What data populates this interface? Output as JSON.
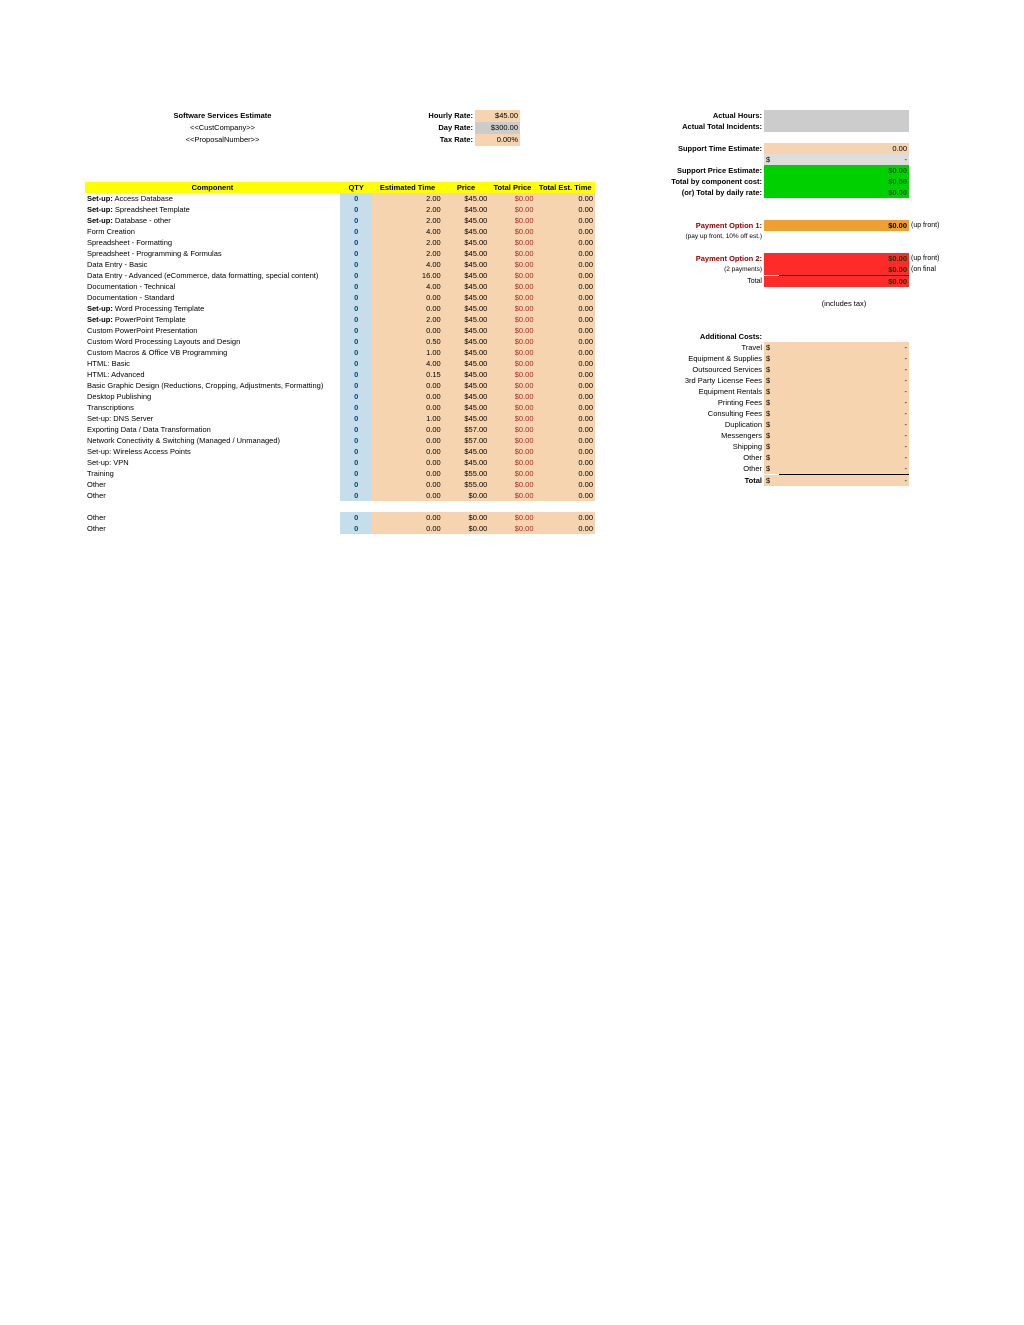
{
  "header": {
    "title": "Software Services Estimate",
    "cust": "<<CustCompany>>",
    "propno": "<<ProposalNumber>>",
    "rates": {
      "hourly_lbl": "Hourly Rate:",
      "hourly_val": "$45.00",
      "day_lbl": "Day Rate:",
      "day_val": "$300.00",
      "tax_lbl": "Tax Rate:",
      "tax_val": "0.00%"
    }
  },
  "table": {
    "hdr": {
      "component": "Component",
      "qty": "QTY",
      "est": "Estimated Time",
      "price": "Price",
      "tprice": "Total Price",
      "ttime": "Total Est. Time"
    },
    "rows": [
      {
        "name": "__B__Set-up:__N__ Access Database",
        "qty": "0",
        "est": "2.00",
        "price": "$45.00",
        "tp": "$0.00",
        "tt": "0.00"
      },
      {
        "name": "__B__Set-up:__N__ Spreadsheet Template",
        "qty": "0",
        "est": "2.00",
        "price": "$45.00",
        "tp": "$0.00",
        "tt": "0.00"
      },
      {
        "name": "__B__Set-up:__N__ Database - other",
        "qty": "0",
        "est": "2.00",
        "price": "$45.00",
        "tp": "$0.00",
        "tt": "0.00"
      },
      {
        "name": "Form Creation",
        "qty": "0",
        "est": "4.00",
        "price": "$45.00",
        "tp": "$0.00",
        "tt": "0.00"
      },
      {
        "name": "Spreadsheet - Formatting",
        "qty": "0",
        "est": "2.00",
        "price": "$45.00",
        "tp": "$0.00",
        "tt": "0.00"
      },
      {
        "name": "Spreadsheet - Programming & Formulas",
        "qty": "0",
        "est": "2.00",
        "price": "$45.00",
        "tp": "$0.00",
        "tt": "0.00"
      },
      {
        "name": "Data Entry - Basic",
        "qty": "0",
        "est": "4.00",
        "price": "$45.00",
        "tp": "$0.00",
        "tt": "0.00"
      },
      {
        "name": "Data Entry - Advanced (eCommerce, data formatting, special content)",
        "qty": "0",
        "est": "16.00",
        "price": "$45.00",
        "tp": "$0.00",
        "tt": "0.00"
      },
      {
        "name": "Documentation - Technical",
        "qty": "0",
        "est": "4.00",
        "price": "$45.00",
        "tp": "$0.00",
        "tt": "0.00"
      },
      {
        "name": "Documentation - Standard",
        "qty": "0",
        "est": "0.00",
        "price": "$45.00",
        "tp": "$0.00",
        "tt": "0.00"
      },
      {
        "name": "__B__Set-up:__N__ Word Processing Template",
        "qty": "0",
        "est": "0.00",
        "price": "$45.00",
        "tp": "$0.00",
        "tt": "0.00"
      },
      {
        "name": "__B__Set-up:__N__ PowerPoint Template",
        "qty": "0",
        "est": "2.00",
        "price": "$45.00",
        "tp": "$0.00",
        "tt": "0.00"
      },
      {
        "name": "Custom PowerPoint Presentation",
        "qty": "0",
        "est": "0.00",
        "price": "$45.00",
        "tp": "$0.00",
        "tt": "0.00"
      },
      {
        "name": "Custom Word Processing Layouts and Design",
        "qty": "0",
        "est": "0.50",
        "price": "$45.00",
        "tp": "$0.00",
        "tt": "0.00"
      },
      {
        "name": "Custom Macros & Office VB Programming",
        "qty": "0",
        "est": "1.00",
        "price": "$45.00",
        "tp": "$0.00",
        "tt": "0.00"
      },
      {
        "name": "HTML: Basic",
        "qty": "0",
        "est": "4.00",
        "price": "$45.00",
        "tp": "$0.00",
        "tt": "0.00"
      },
      {
        "name": "HTML: Advanced",
        "qty": "0",
        "est": "0.15",
        "price": "$45.00",
        "tp": "$0.00",
        "tt": "0.00"
      },
      {
        "name": "Basic Graphic Design (Reductions, Cropping, Adjustments, Formatting)",
        "qty": "0",
        "est": "0.00",
        "price": "$45.00",
        "tp": "$0.00",
        "tt": "0.00"
      },
      {
        "name": "Desktop Publishing",
        "qty": "0",
        "est": "0.00",
        "price": "$45.00",
        "tp": "$0.00",
        "tt": "0.00"
      },
      {
        "name": "Transcriptions",
        "qty": "0",
        "est": "0.00",
        "price": "$45.00",
        "tp": "$0.00",
        "tt": "0.00"
      },
      {
        "name": "Set-up: DNS Server",
        "qty": "0",
        "est": "1.00",
        "price": "$45.00",
        "tp": "$0.00",
        "tt": "0.00"
      },
      {
        "name": "Exporting Data / Data Transformation",
        "qty": "0",
        "est": "0.00",
        "price": "$57.00",
        "tp": "$0.00",
        "tt": "0.00"
      },
      {
        "name": "Network Conectivity & Switching (Managed / Unmanaged)",
        "qty": "0",
        "est": "0.00",
        "price": "$57.00",
        "tp": "$0.00",
        "tt": "0.00"
      },
      {
        "name": "Set-up: Wireless Access Points",
        "qty": "0",
        "est": "0.00",
        "price": "$45.00",
        "tp": "$0.00",
        "tt": "0.00"
      },
      {
        "name": "Set-up: VPN",
        "qty": "0",
        "est": "0.00",
        "price": "$45.00",
        "tp": "$0.00",
        "tt": "0.00"
      },
      {
        "name": "Training",
        "qty": "0",
        "est": "0.00",
        "price": "$55.00",
        "tp": "$0.00",
        "tt": "0.00"
      },
      {
        "name": "Other",
        "qty": "0",
        "est": "0.00",
        "price": "$55.00",
        "tp": "$0.00",
        "tt": "0.00"
      },
      {
        "name": "Other",
        "qty": "0",
        "est": "0.00",
        "price": "$0.00",
        "tp": "$0.00",
        "tt": "0.00"
      },
      {
        "name": "__BLANK__",
        "qty": "",
        "est": "",
        "price": "",
        "tp": "",
        "tt": ""
      },
      {
        "name": "Other",
        "qty": "0",
        "est": "0.00",
        "price": "$0.00",
        "tp": "$0.00",
        "tt": "0.00"
      },
      {
        "name": "Other",
        "qty": "0",
        "est": "0.00",
        "price": "$0.00",
        "tp": "$0.00",
        "tt": "0.00"
      }
    ]
  },
  "right": {
    "actual_hours_lbl": "Actual Hours:",
    "actual_incidents_lbl": "Actual Total Incidents:",
    "support_time_lbl": "Support Time Estimate:",
    "support_time_val": "0.00",
    "dash": "-",
    "dollar": "$",
    "support_price_lbl": "Support Price Estimate:",
    "support_price_val": "$0.00",
    "total_comp_lbl": "Total by component cost:",
    "total_comp_val": "$0.00",
    "total_daily_lbl": "(or) Total by daily rate:",
    "total_daily_val": "$0.00",
    "pay1_lbl": "Payment Option 1:",
    "pay1_val": "$0.00",
    "pay1_note": "(up front)",
    "pay1_sub": "(pay up front, 10% off est.)",
    "pay2_lbl": "Payment Option 2:",
    "pay2_val": "$0.00",
    "pay2_note": "(up front)",
    "pay2_sub": "(2 payments)",
    "pay2_val2": "$0.00",
    "pay2_note2": "(on final approval)",
    "pay2_total_lbl": "Total",
    "pay2_total_val": "$0.00",
    "includes_tax": "(includes tax)",
    "addcosts_hdr": "Additional Costs:",
    "addcosts": [
      {
        "lbl": "Travel",
        "sym": "$",
        "val": "-"
      },
      {
        "lbl": "Equipment & Supplies",
        "sym": "$",
        "val": "-"
      },
      {
        "lbl": "Outsourced Services",
        "sym": "$",
        "val": "-"
      },
      {
        "lbl": "3rd Party License Fees",
        "sym": "$",
        "val": "-"
      },
      {
        "lbl": "Equipment Rentals",
        "sym": "$",
        "val": "-"
      },
      {
        "lbl": "Printing Fees",
        "sym": "$",
        "val": "-"
      },
      {
        "lbl": "Consulting Fees",
        "sym": "$",
        "val": "-"
      },
      {
        "lbl": "Duplication",
        "sym": "$",
        "val": "-"
      },
      {
        "lbl": "Messengers",
        "sym": "$",
        "val": "-"
      },
      {
        "lbl": "Shipping",
        "sym": "$",
        "val": "-"
      },
      {
        "lbl": "Other",
        "sym": "$",
        "val": "-"
      },
      {
        "lbl": "Other",
        "sym": "$",
        "val": "-"
      }
    ],
    "addcosts_total_lbl": "Total",
    "addcosts_total_sym": "$",
    "addcosts_total_val": "-"
  }
}
